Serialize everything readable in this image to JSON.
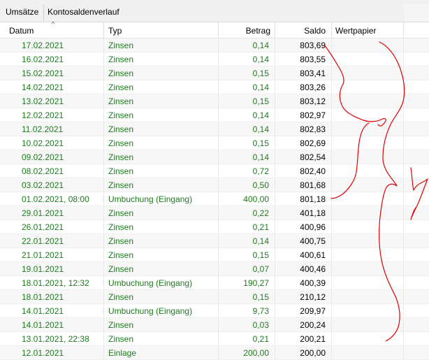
{
  "tabs": [
    "Umsätze",
    "Kontosaldenverlauf"
  ],
  "columns": {
    "datum": "Datum",
    "typ": "Typ",
    "betrag": "Betrag",
    "saldo": "Saldo",
    "wertpapier": "Wertpapier"
  },
  "rows": [
    {
      "datum": "17.02.2021",
      "typ": "Zinsen",
      "betrag": "0,14",
      "saldo": "803,69"
    },
    {
      "datum": "16.02.2021",
      "typ": "Zinsen",
      "betrag": "0,14",
      "saldo": "803,55"
    },
    {
      "datum": "15.02.2021",
      "typ": "Zinsen",
      "betrag": "0,15",
      "saldo": "803,41"
    },
    {
      "datum": "14.02.2021",
      "typ": "Zinsen",
      "betrag": "0,14",
      "saldo": "803,26"
    },
    {
      "datum": "13.02.2021",
      "typ": "Zinsen",
      "betrag": "0,15",
      "saldo": "803,12"
    },
    {
      "datum": "12.02.2021",
      "typ": "Zinsen",
      "betrag": "0,14",
      "saldo": "802,97"
    },
    {
      "datum": "11.02.2021",
      "typ": "Zinsen",
      "betrag": "0,14",
      "saldo": "802,83"
    },
    {
      "datum": "10.02.2021",
      "typ": "Zinsen",
      "betrag": "0,15",
      "saldo": "802,69"
    },
    {
      "datum": "09.02.2021",
      "typ": "Zinsen",
      "betrag": "0,14",
      "saldo": "802,54"
    },
    {
      "datum": "08.02.2021",
      "typ": "Zinsen",
      "betrag": "0,72",
      "saldo": "802,40"
    },
    {
      "datum": "03.02.2021",
      "typ": "Zinsen",
      "betrag": "0,50",
      "saldo": "801,68"
    },
    {
      "datum": "01.02.2021, 08:00",
      "typ": "Umbuchung (Eingang)",
      "betrag": "400,00",
      "saldo": "801,18"
    },
    {
      "datum": "29.01.2021",
      "typ": "Zinsen",
      "betrag": "0,22",
      "saldo": "401,18"
    },
    {
      "datum": "26.01.2021",
      "typ": "Zinsen",
      "betrag": "0,21",
      "saldo": "400,96"
    },
    {
      "datum": "22.01.2021",
      "typ": "Zinsen",
      "betrag": "0,14",
      "saldo": "400,75"
    },
    {
      "datum": "21.01.2021",
      "typ": "Zinsen",
      "betrag": "0,15",
      "saldo": "400,61"
    },
    {
      "datum": "19.01.2021",
      "typ": "Zinsen",
      "betrag": "0,07",
      "saldo": "400,46"
    },
    {
      "datum": "18.01.2021, 12:32",
      "typ": "Umbuchung (Eingang)",
      "betrag": "190,27",
      "saldo": "400,39"
    },
    {
      "datum": "18.01.2021",
      "typ": "Zinsen",
      "betrag": "0,15",
      "saldo": "210,12"
    },
    {
      "datum": "14.01.2021",
      "typ": "Umbuchung (Eingang)",
      "betrag": "9,73",
      "saldo": "209,97"
    },
    {
      "datum": "14.01.2021",
      "typ": "Zinsen",
      "betrag": "0,03",
      "saldo": "200,24"
    },
    {
      "datum": "13.01.2021, 22:38",
      "typ": "Zinsen",
      "betrag": "0,21",
      "saldo": "200,21"
    },
    {
      "datum": "12.01.2021",
      "typ": "Einlage",
      "betrag": "200,00",
      "saldo": "200,00"
    }
  ],
  "colors": {
    "text_green": "#1f7a1f",
    "annotation_red": "#e00000"
  }
}
